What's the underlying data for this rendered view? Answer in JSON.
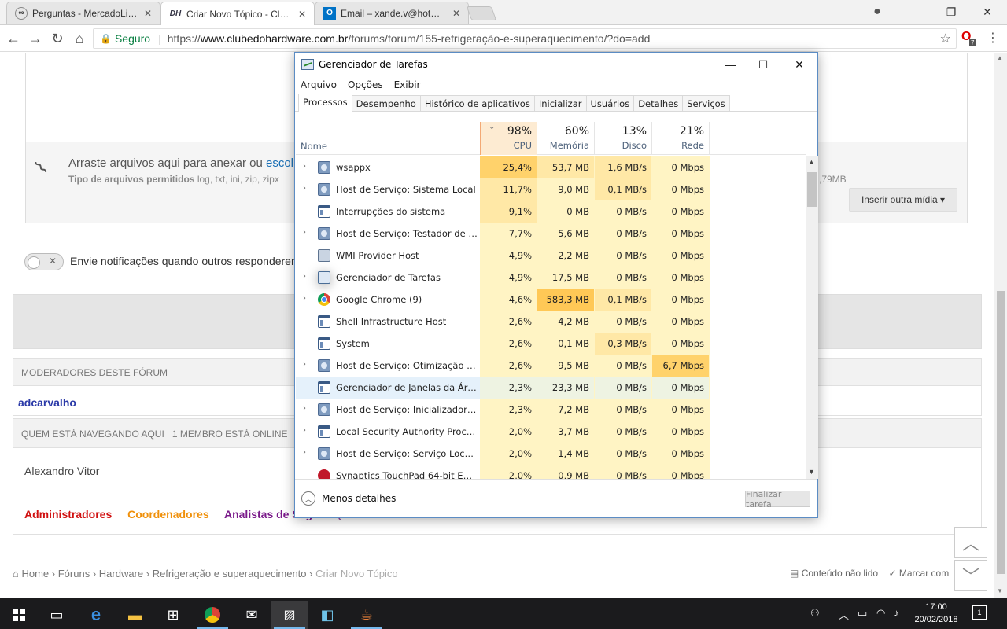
{
  "browser": {
    "tabs": [
      {
        "title": "Perguntas - MercadoLivre",
        "icon": "handshake-icon"
      },
      {
        "title": "Criar Novo Tópico - Clube do Hardware",
        "icon": "cdh-icon",
        "favicon_text": "DH"
      },
      {
        "title": "Email – xande.v@hotmail.com",
        "icon": "outlook-icon",
        "favicon_text": "O"
      }
    ],
    "secure_label": "Seguro",
    "url_scheme": "https://",
    "url_domain": "www.clubedohardware.com.br",
    "url_path": "/forums/forum/155-refrigeração-e-superaquecimento/?do=add",
    "extension_badge": "7"
  },
  "page": {
    "attach_text": "Arraste arquivos aqui para anexar ou ",
    "attach_link": "escol",
    "attach_types_label": "Tipo de arquivos permitidos",
    "attach_types": " log, txt, ini, zip, zipx",
    "attach_size": ",79MB",
    "insert_media": "Inserir outra mídia ▾",
    "notify_text": "Envie notificações quando outros responderem",
    "moderators_header": "Moderadores deste fórum",
    "moderator_name": "adcarvalho",
    "online_header": "Quem está navegando aqui",
    "online_count": "1 membro está online",
    "member_name": "Alexandro Vitor",
    "groups": {
      "admin": "Administradores",
      "coord": "Coordenadores",
      "anal": "Analistas de Segurança"
    },
    "breadcrumb": {
      "home": "Home",
      "b1": "Fóruns",
      "b2": "Hardware",
      "b3": "Refrigeração e superaquecimento",
      "current": "Criar Novo Tópico"
    },
    "right_links": {
      "unread": "Conteúdo não lido",
      "mark": "Marcar com"
    }
  },
  "taskmgr": {
    "title": "Gerenciador de Tarefas",
    "menu": [
      "Arquivo",
      "Opções",
      "Exibir"
    ],
    "tabs": [
      "Processos",
      "Desempenho",
      "Histórico de aplicativos",
      "Inicializar",
      "Usuários",
      "Detalhes",
      "Serviços"
    ],
    "columns": {
      "name": "Nome",
      "cpu": {
        "pct": "98%",
        "label": "CPU"
      },
      "mem": {
        "pct": "60%",
        "label": "Memória"
      },
      "disk": {
        "pct": "13%",
        "label": "Disco"
      },
      "net": {
        "pct": "21%",
        "label": "Rede"
      }
    },
    "rows": [
      {
        "name": "wsappx",
        "icon": "gear",
        "expand": true,
        "cpu": "25,4%",
        "mem": "53,7 MB",
        "disk": "1,6 MB/s",
        "net": "0 Mbps",
        "heat": [
          3,
          2,
          2,
          1
        ]
      },
      {
        "name": "Host de Serviço: Sistema Local",
        "icon": "gear",
        "expand": true,
        "cpu": "11,7%",
        "mem": "9,0 MB",
        "disk": "0,1 MB/s",
        "net": "0 Mbps",
        "heat": [
          2,
          1,
          2,
          1
        ]
      },
      {
        "name": "Interrupções do sistema",
        "icon": "win",
        "expand": false,
        "cpu": "9,1%",
        "mem": "0 MB",
        "disk": "0 MB/s",
        "net": "0 Mbps",
        "heat": [
          2,
          1,
          1,
          1
        ]
      },
      {
        "name": "Host de Serviço: Testador de ins...",
        "icon": "gear",
        "expand": true,
        "cpu": "7,7%",
        "mem": "5,6 MB",
        "disk": "0 MB/s",
        "net": "0 Mbps",
        "heat": [
          1,
          1,
          1,
          1
        ]
      },
      {
        "name": "WMI Provider Host",
        "icon": "wmi",
        "expand": false,
        "cpu": "4,9%",
        "mem": "2,2 MB",
        "disk": "0 MB/s",
        "net": "0 Mbps",
        "heat": [
          1,
          1,
          1,
          1
        ]
      },
      {
        "name": "Gerenciador de Tarefas",
        "icon": "tm",
        "expand": true,
        "cpu": "4,9%",
        "mem": "17,5 MB",
        "disk": "0 MB/s",
        "net": "0 Mbps",
        "heat": [
          1,
          1,
          1,
          1
        ]
      },
      {
        "name": "Google Chrome (9)",
        "icon": "chrome",
        "expand": true,
        "cpu": "4,6%",
        "mem": "583,3 MB",
        "disk": "0,1 MB/s",
        "net": "0 Mbps",
        "heat": [
          1,
          4,
          2,
          1
        ]
      },
      {
        "name": "Shell Infrastructure Host",
        "icon": "win",
        "expand": false,
        "cpu": "2,6%",
        "mem": "4,2 MB",
        "disk": "0 MB/s",
        "net": "0 Mbps",
        "heat": [
          1,
          1,
          1,
          1
        ]
      },
      {
        "name": "System",
        "icon": "win",
        "expand": false,
        "cpu": "2,6%",
        "mem": "0,1 MB",
        "disk": "0,3 MB/s",
        "net": "0 Mbps",
        "heat": [
          1,
          1,
          2,
          1
        ]
      },
      {
        "name": "Host de Serviço: Otimização de ...",
        "icon": "gear",
        "expand": true,
        "cpu": "2,6%",
        "mem": "9,5 MB",
        "disk": "0 MB/s",
        "net": "6,7 Mbps",
        "heat": [
          1,
          1,
          1,
          3
        ]
      },
      {
        "name": "Gerenciador de Janelas da Área ...",
        "icon": "win",
        "expand": false,
        "cpu": "2,3%",
        "mem": "23,3 MB",
        "disk": "0 MB/s",
        "net": "0 Mbps",
        "heat": [
          1,
          1,
          1,
          1
        ],
        "selected": true
      },
      {
        "name": "Host de Serviço: Inicializador de...",
        "icon": "gear",
        "expand": true,
        "cpu": "2,3%",
        "mem": "7,2 MB",
        "disk": "0 MB/s",
        "net": "0 Mbps",
        "heat": [
          1,
          1,
          1,
          1
        ]
      },
      {
        "name": "Local Security Authority Proces...",
        "icon": "win",
        "expand": true,
        "cpu": "2,0%",
        "mem": "3,7 MB",
        "disk": "0 MB/s",
        "net": "0 Mbps",
        "heat": [
          1,
          1,
          1,
          1
        ]
      },
      {
        "name": "Host de Serviço: Serviço Local (...",
        "icon": "gear",
        "expand": true,
        "cpu": "2,0%",
        "mem": "1,4 MB",
        "disk": "0 MB/s",
        "net": "0 Mbps",
        "heat": [
          1,
          1,
          1,
          1
        ]
      },
      {
        "name": "Synaptics TouchPad 64-bit Enh...",
        "icon": "syn",
        "expand": false,
        "cpu": "2,0%",
        "mem": "0,9 MB",
        "disk": "0 MB/s",
        "net": "0 Mbps",
        "heat": [
          1,
          1,
          1,
          1
        ]
      }
    ],
    "less_details": "Menos detalhes",
    "end_task": "Finalizar tarefa"
  },
  "taskbar": {
    "time": "17:00",
    "date": "20/02/2018",
    "notifications": "1"
  }
}
